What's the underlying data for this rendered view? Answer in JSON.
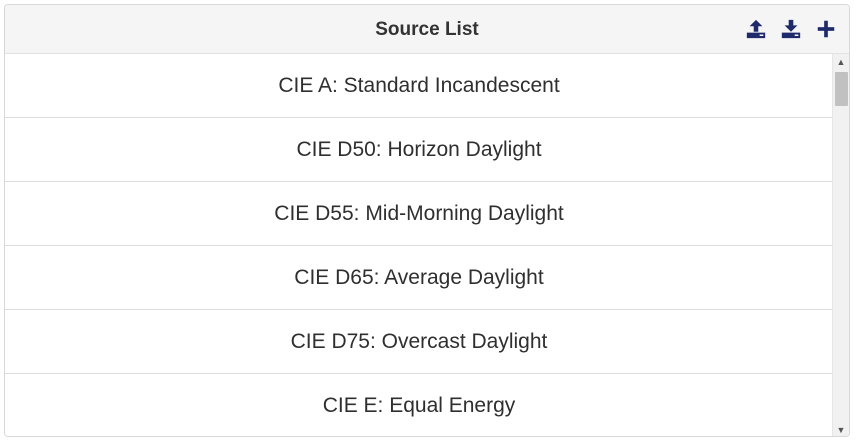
{
  "header": {
    "title": "Source List",
    "actions": [
      {
        "name": "upload",
        "icon": "upload-icon"
      },
      {
        "name": "download",
        "icon": "download-icon"
      },
      {
        "name": "add",
        "icon": "plus-icon"
      }
    ]
  },
  "list": {
    "items": [
      {
        "label": "CIE A: Standard Incandescent"
      },
      {
        "label": "CIE D50: Horizon Daylight"
      },
      {
        "label": "CIE D55: Mid-Morning Daylight"
      },
      {
        "label": "CIE D65: Average Daylight"
      },
      {
        "label": "CIE D75: Overcast Daylight"
      },
      {
        "label": "CIE E: Equal Energy"
      }
    ]
  },
  "colors": {
    "icon": "#1f2a6b",
    "header_bg": "#f5f5f5",
    "text": "#2f2f2f"
  },
  "scrollbar": {
    "position_fraction": 0.0
  }
}
